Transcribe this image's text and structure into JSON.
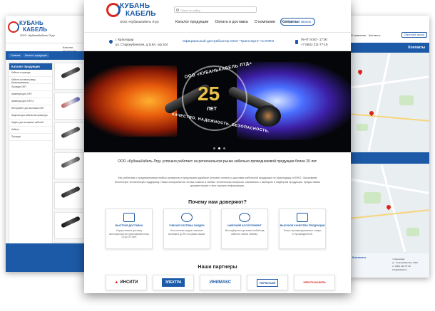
{
  "brand": {
    "logo_line1": "КУБАНЬ",
    "logo_line2": "КАБЕЛЬ",
    "tagline": "ООО «КубаньКабель Лтд»",
    "colors": {
      "primary": "#1c5aa7",
      "accent": "#d9261c",
      "gold": "#e7c14a"
    }
  },
  "left_page": {
    "nav_label": "Каталог продукции",
    "breadcrumb": [
      "Главная",
      "Каталог продукции"
    ],
    "sidebar_title": "Каталог продукции",
    "sidebar_items": [
      "Кабели и провода",
      "Кабели силовые (медь, бронированные)",
      "Провода СИП",
      "Арматура для СИП",
      "Арматура для СИП-4",
      "Инструмент для монтажа СИП",
      "Изделия для кабельной арматуры",
      "Муфты для концевых кабелей",
      "Кабели",
      "Провода"
    ]
  },
  "main_page": {
    "search_placeholder": "Поиск по сайту",
    "menu": [
      "Каталог продукции",
      "Оплата и доставка",
      "О компании",
      "Контакты"
    ],
    "callback_label": "Обратный звонок",
    "address_line1": "г. Краснодар",
    "address_line2": "ул. Старокубанская, д.118А, оф.104",
    "distributor_text": "Официальный дистрибьютор ООО \"Транснерго\" по ЮФО",
    "hours": "Пн-Пт 8:00 - 17:00",
    "phone": "+7 (861) 211-77-19",
    "hero": {
      "number": "25",
      "let_label": "ЛЕТ",
      "ring_top": "ООО «КУБАНЬКАБЕЛЬ ЛТД»",
      "ring_bottom": "КАЧЕСТВО. НАДЕЖНОСТЬ. БЕЗОПАСНОСТЬ.",
      "active_slide": 2,
      "slide_count": 3
    },
    "intro_title": "ООО «КубаньКабель Лтд» успешно работает на региональном рынке кабельно-проводниковой продукции более 20 лет.",
    "intro_text": "Мы работаем с предприятиями любых размеров и предлагаем удобные условия оплаты и доставки кабельной продукции по Краснодару и ЮФО. Оказываем беспечную техническую поддержку. Наши специалисты готовы помочь в любых технических вопросах, связанных с выбором и подбором продукции, предоставим документацию и всю нужную информацию.",
    "why_title": "Почему нам доверяют?",
    "features": [
      {
        "icon": "truck-icon",
        "title": "БЫСТРАЯ ДОСТАВКА",
        "text": "Осуществляем доставку автотранспортом грузоподъемностью 1,5 до 20 тонн."
      },
      {
        "icon": "discount-icon",
        "title": "ГИБКАЯ СИСТЕМА СКИДОК",
        "text": "Наш система скидок позволяет экономить до 5% на суммы свыше."
      },
      {
        "icon": "assortment-icon",
        "title": "ШИРОКИЙ АССОРТИМЕНТ",
        "text": "Мы подберем и доставим любой вид кабеля в любые объемы."
      },
      {
        "icon": "quality-icon",
        "title": "ВЫСОКОЕ КАЧЕСТВО ПРОДУКЦИИ",
        "text": "Только сертифицированные товары от производителей."
      }
    ],
    "partners_title": "Наши партнеры",
    "partners": [
      "ИНСИТИ",
      "ЭЛЕКТРА",
      "ИНИМАКС",
      "ПЕРМСКИЙ",
      "ЭЛЕКТРОКАБЕЛЬ"
    ]
  },
  "right_page": {
    "menu": [
      "О компании",
      "Контакты"
    ],
    "callback_label": "Обратный звонок",
    "banner_title": "Контакты",
    "footer_title": "Контакты",
    "footer_lines": [
      "г. Краснодар",
      "ул. Старокубанская, 118А",
      "+7 (861) 211-77-19",
      "info@kubkab.ru"
    ]
  }
}
